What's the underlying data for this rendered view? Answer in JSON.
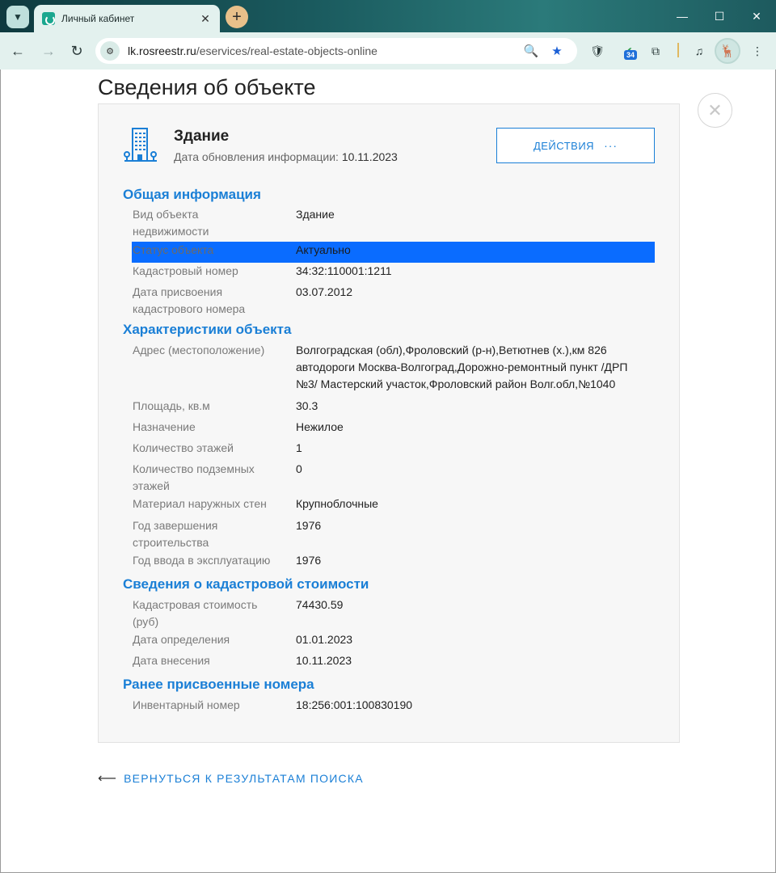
{
  "browser": {
    "tab_title": "Личный кабинет",
    "url_domain": "lk.rosreestr.ru",
    "url_path": "/eservices/real-estate-objects-online",
    "extension_badge": "34"
  },
  "page": {
    "title": "Сведения об объекте",
    "object_type": "Здание",
    "update_label": "Дата обновления информации:",
    "update_date": "10.11.2023",
    "actions_label": "ДЕЙСТВИЯ",
    "actions_dots": "···",
    "back_link": "ВЕРНУТЬСЯ К РЕЗУЛЬТАТАМ ПОИСКА"
  },
  "sections": {
    "general": {
      "title": "Общая информация",
      "rows": [
        {
          "label": "Вид объекта недвижимости",
          "value": "Здание"
        },
        {
          "label": "Статус объекта",
          "value": "Актуально"
        },
        {
          "label": "Кадастровый номер",
          "value": "34:32:110001:1211"
        },
        {
          "label": "Дата присвоения кадастрового номера",
          "value": "03.07.2012"
        }
      ]
    },
    "characteristics": {
      "title": "Характеристики объекта",
      "rows": [
        {
          "label": "Адрес (местоположение)",
          "value": "Волгоградская (обл),Фроловский (р-н),Ветютнев (х.),км 826 автодороги Москва-Волгоград,Дорожно-ремонтный пункт /ДРП №3/ Мастерский участок,Фроловский район Волг.обл,№1040"
        },
        {
          "label": "Площадь, кв.м",
          "value": "30.3"
        },
        {
          "label": "Назначение",
          "value": "Нежилое"
        },
        {
          "label": "Количество этажей",
          "value": "1"
        },
        {
          "label": "Количество подземных этажей",
          "value": "0"
        },
        {
          "label": "Материал наружных стен",
          "value": "Крупноблочные"
        },
        {
          "label": "Год завершения строительства",
          "value": "1976"
        },
        {
          "label": "Год ввода в эксплуатацию",
          "value": "1976"
        }
      ]
    },
    "cadastral_value": {
      "title": "Сведения о кадастровой стоимости",
      "rows": [
        {
          "label": "Кадастровая стоимость (руб)",
          "value": "74430.59"
        },
        {
          "label": "Дата определения",
          "value": "01.01.2023"
        },
        {
          "label": "Дата внесения",
          "value": "10.11.2023"
        }
      ]
    },
    "previous_numbers": {
      "title": "Ранее присвоенные номера",
      "rows": [
        {
          "label": "Инвентарный номер",
          "value": "18:256:001:100830190"
        }
      ]
    }
  },
  "colors": {
    "accent": "#1a7fd6",
    "highlight": "#0a6cff",
    "tab_bg": "#e3f1ee"
  }
}
